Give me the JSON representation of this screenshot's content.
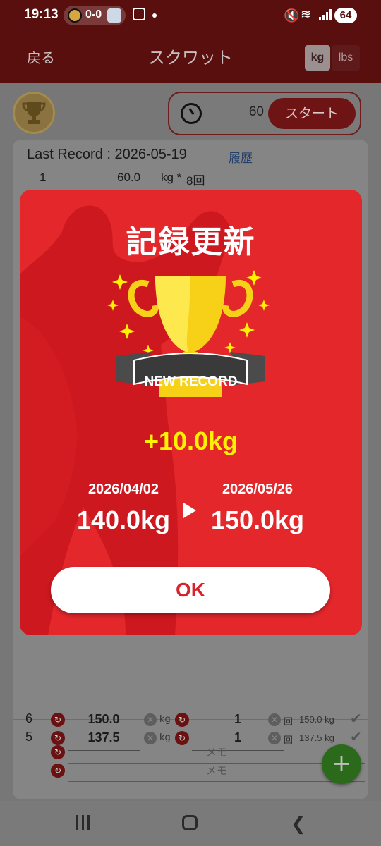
{
  "status_bar": {
    "time": "19:13",
    "score": "0-0",
    "battery": "64",
    "icons": [
      "screenshot-icon",
      "mute-icon",
      "wifi-icon",
      "signal-icon",
      "battery-icon"
    ]
  },
  "app_bar": {
    "back_label": "戻る",
    "title": "スクワット",
    "unit_kg": "kg",
    "unit_lbs": "lbs"
  },
  "timer": {
    "seconds": "60",
    "start_label": "スタート"
  },
  "last_record": {
    "label": "Last Record : 2026-05-19",
    "history_link": "履歴",
    "row": {
      "set": "1",
      "weight": "60.0",
      "unit": "kg *",
      "reps": "8回"
    }
  },
  "sets": [
    {
      "num": "5",
      "weight": "137.5",
      "weight_unit": "kg",
      "reps": "1",
      "reps_unit": "回",
      "volume": "137.5 kg",
      "memo_placeholder": "メモ"
    },
    {
      "num": "6",
      "weight": "150.0",
      "weight_unit": "kg",
      "reps": "1",
      "reps_unit": "回",
      "volume": "150.0 kg",
      "memo_placeholder": "メモ"
    }
  ],
  "fab_label": "+",
  "modal": {
    "title": "記録更新",
    "badge": "NEW RECORD",
    "diff": "+10.0kg",
    "old_date": "2026/04/02",
    "old_value": "140.0kg",
    "new_date": "2026/05/26",
    "new_value": "150.0kg",
    "ok_label": "OK",
    "colors": {
      "background": "#e3272b",
      "accent": "#fff200",
      "trophy": "#f7d117"
    }
  }
}
